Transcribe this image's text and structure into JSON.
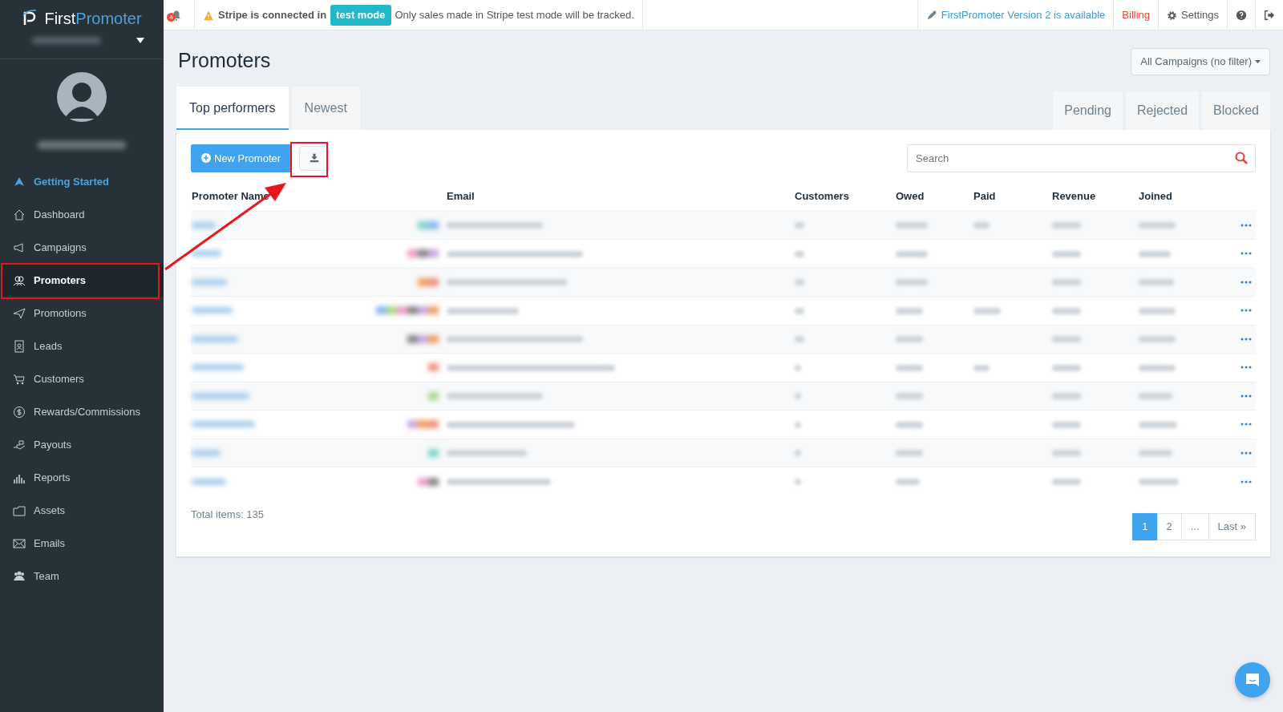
{
  "brand": {
    "first": "First",
    "second": "Promoter"
  },
  "notifications": {
    "count": "4"
  },
  "alert": {
    "lead": "Stripe is connected in",
    "badge": "test mode",
    "text": "Only sales made in Stripe test mode will be tracked."
  },
  "top_links": [
    {
      "kind": "upgrade",
      "label": "FirstPromoter Version 2 is available"
    },
    {
      "kind": "billing",
      "label": "Billing"
    },
    {
      "kind": "settings",
      "label": "Settings"
    },
    {
      "kind": "help"
    },
    {
      "kind": "logout"
    }
  ],
  "sidebar": {
    "items": [
      {
        "label": "Getting Started",
        "kind": "highlight",
        "selected": false
      },
      {
        "label": "Dashboard",
        "kind": "link",
        "selected": false
      },
      {
        "label": "Campaigns",
        "kind": "link",
        "selected": false
      },
      {
        "label": "Promoters",
        "kind": "link",
        "selected": true
      },
      {
        "label": "Promotions",
        "kind": "link",
        "selected": false
      },
      {
        "label": "Leads",
        "kind": "link",
        "selected": false
      },
      {
        "label": "Customers",
        "kind": "link",
        "selected": false
      },
      {
        "label": "Rewards/Commissions",
        "kind": "link",
        "selected": false
      },
      {
        "label": "Payouts",
        "kind": "link",
        "selected": false
      },
      {
        "label": "Reports",
        "kind": "link",
        "selected": false
      },
      {
        "label": "Assets",
        "kind": "link",
        "selected": false
      },
      {
        "label": "Emails",
        "kind": "link",
        "selected": false
      },
      {
        "label": "Team",
        "kind": "link",
        "selected": false
      }
    ]
  },
  "page": {
    "title": "Promoters",
    "campaign_filter": "All Campaigns (no filter)"
  },
  "tabs": [
    {
      "label": "Top performers",
      "selected": true
    },
    {
      "label": "Newest",
      "selected": false
    }
  ],
  "status_tabs": [
    {
      "label": "Pending"
    },
    {
      "label": "Rejected"
    },
    {
      "label": "Blocked"
    }
  ],
  "toolbar": {
    "new_button": "New Promoter",
    "search": {
      "placeholder": "Search"
    }
  },
  "table": {
    "columns": [
      "Promoter Name",
      "Email",
      "Customers",
      "Owed",
      "Paid",
      "Revenue",
      "Joined"
    ],
    "rows": [
      {
        "paid_shown": true
      },
      {
        "paid_shown": false
      },
      {
        "paid_shown": false
      },
      {
        "paid_shown": true
      },
      {
        "paid_shown": false
      },
      {
        "paid_shown": true
      },
      {
        "paid_shown": false
      },
      {
        "paid_shown": false
      },
      {
        "paid_shown": false
      },
      {
        "paid_shown": false
      }
    ]
  },
  "footer": {
    "total": "Total items: 135"
  },
  "pagination": [
    {
      "label": "1",
      "selected": true
    },
    {
      "label": "2",
      "selected": false
    },
    {
      "label": "...",
      "selected": false
    },
    {
      "label": "Last »",
      "selected": false
    }
  ]
}
